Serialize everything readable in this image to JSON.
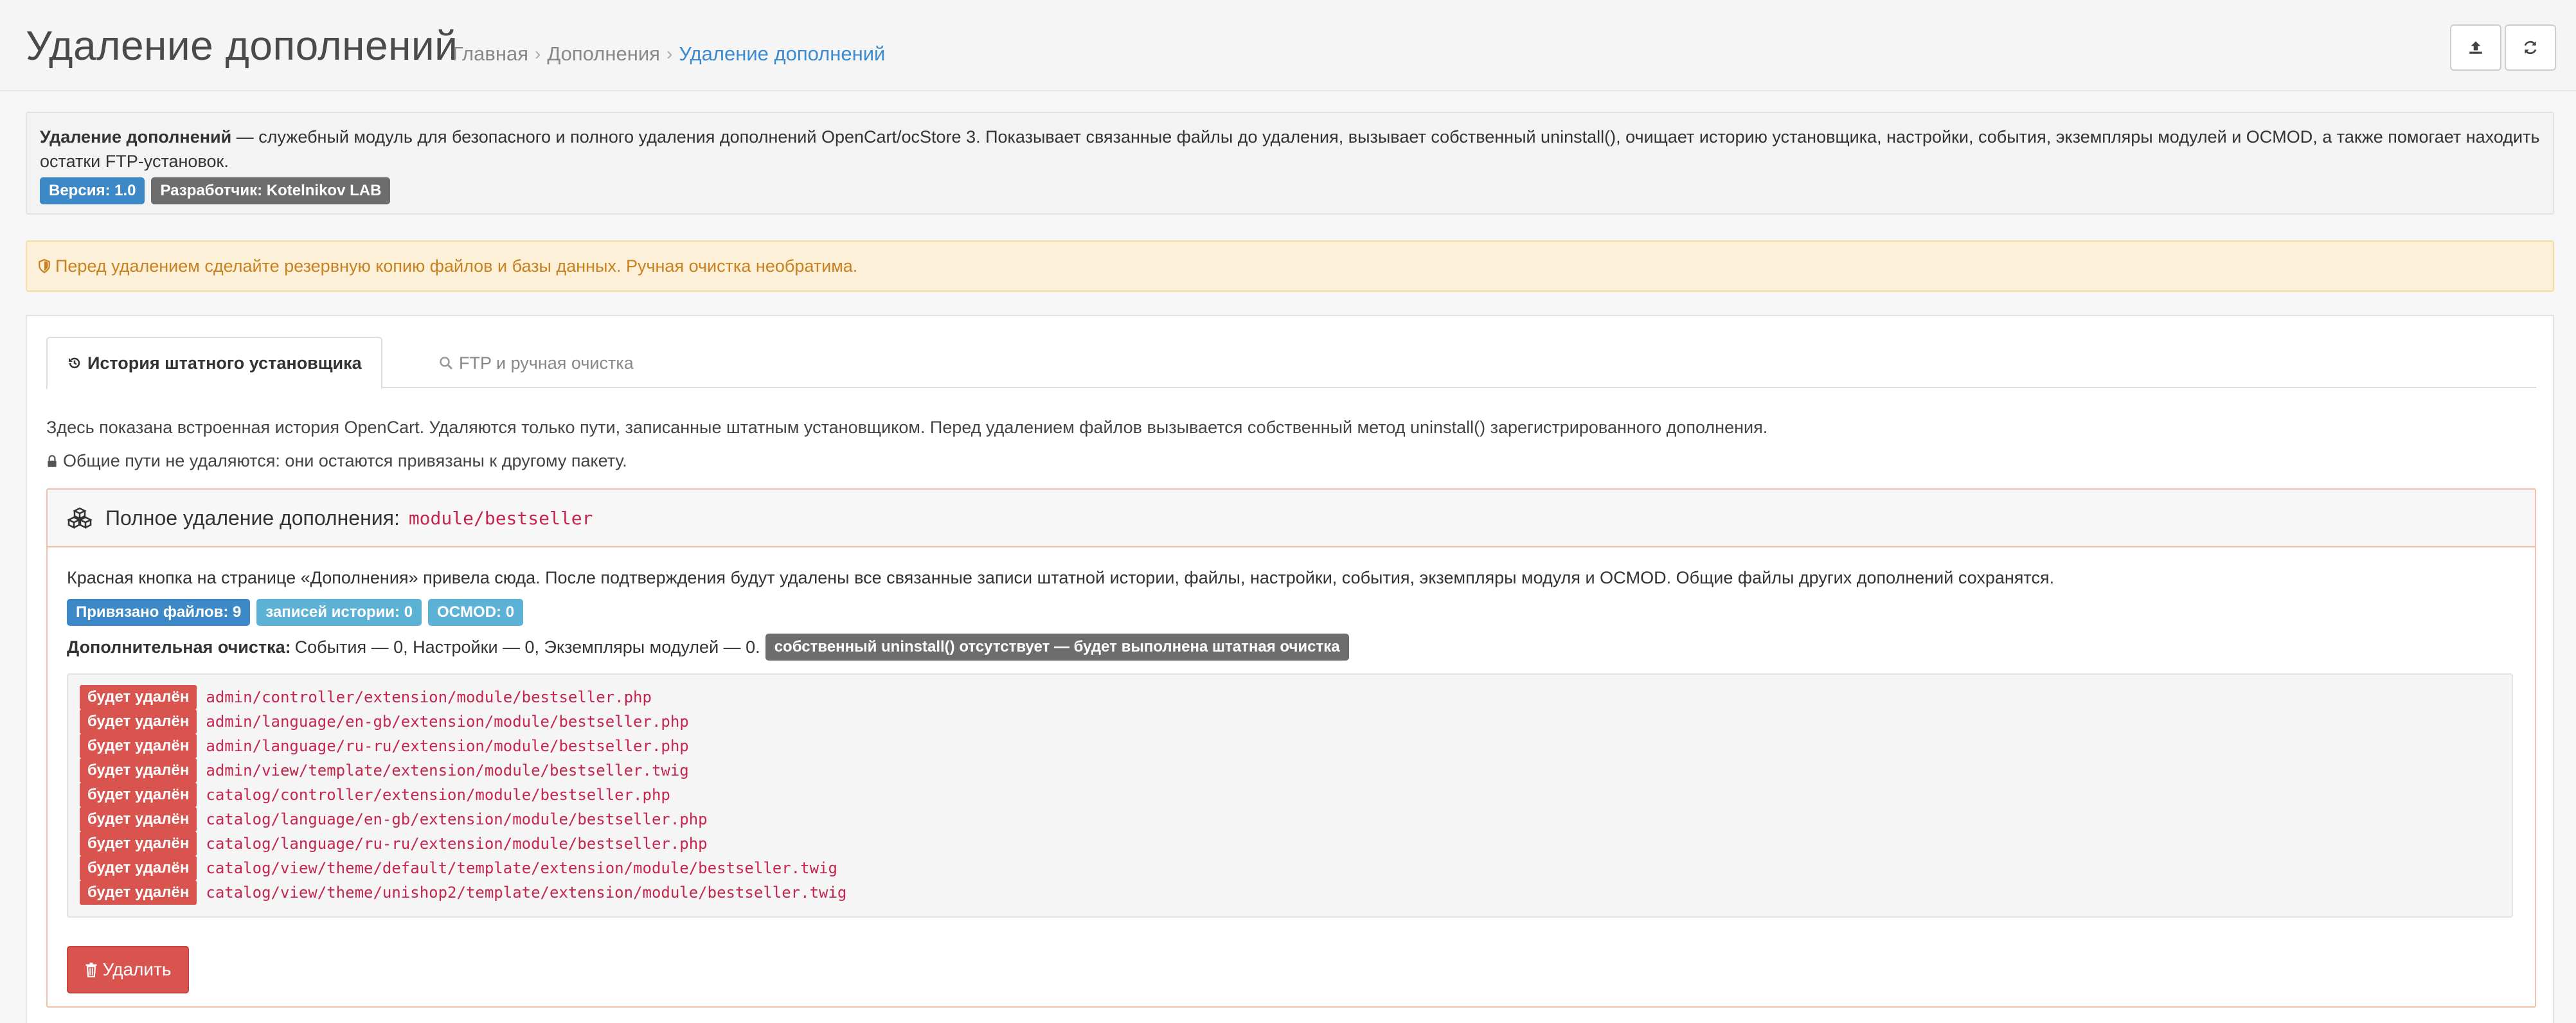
{
  "header": {
    "title": "Удаление дополнений",
    "breadcrumb": [
      "Главная",
      "Дополнения",
      "Удаление дополнений"
    ],
    "buttons": [
      {
        "icon": "upload-icon"
      },
      {
        "icon": "refresh-icon"
      }
    ]
  },
  "info": {
    "module_name": "Удаление дополнений",
    "description": " — служебный модуль для безопасного и полного удаления дополнений OpenCart/ocStore 3. Показывает связанные файлы до удаления, вызывает собственный uninstall(), очищает историю установщика, настройки, события, экземпляры модулей и OCMOD, а также помогает находить остатки FTP-установок.",
    "version_badge": "Версия: 1.0",
    "developer_badge": "Разработчик: Kotelnikov LAB"
  },
  "warning": {
    "text": "Перед удалением сделайте резервную копию файлов и базы данных. Ручная очистка необратима.",
    "icon": "shield-icon"
  },
  "tabs": [
    {
      "label": "История штатного установщика",
      "icon": "history-icon",
      "active": true
    },
    {
      "label": "FTP и ручная очистка",
      "icon": "search-icon",
      "active": false
    }
  ],
  "history_tab": {
    "description": "Здесь показана встроенная история OpenCart. Удаляются только пути, записанные штатным установщиком. Перед удалением файлов вызывается собственный метод uninstall() зарегистрированного дополнения.",
    "note": "Общие пути не удаляются: они остаются привязаны к другому пакету."
  },
  "removal": {
    "title": "Полное удаление дополнения:",
    "code": "module/bestseller",
    "description": "Красная кнопка на странице «Дополнения» привела сюда. После подтверждения будут удалены все связанные записи штатной истории, файлы, настройки, события, экземпляры модуля и OCMOD. Общие файлы других дополнений сохранятся.",
    "badges": {
      "files": "Привязано файлов: 9",
      "history": "записей истории: 0",
      "ocmod": "OCMOD: 0"
    },
    "cleanup_label": "Дополнительная очистка:",
    "cleanup_text": "События — 0, Настройки — 0, Экземпляры модулей — 0.",
    "cleanup_badge": "собственный uninstall() отсутствует — будет выполнена штатная очистка",
    "file_status": "будет удалён",
    "files": [
      "admin/controller/extension/module/bestseller.php",
      "admin/language/en-gb/extension/module/bestseller.php",
      "admin/language/ru-ru/extension/module/bestseller.php",
      "admin/view/template/extension/module/bestseller.twig",
      "catalog/controller/extension/module/bestseller.php",
      "catalog/language/en-gb/extension/module/bestseller.php",
      "catalog/language/ru-ru/extension/module/bestseller.php",
      "catalog/view/theme/default/template/extension/module/bestseller.twig",
      "catalog/view/theme/unishop2/template/extension/module/bestseller.twig"
    ],
    "delete_button": "Удалить"
  },
  "colors": {
    "primary": "#3d89c7",
    "info": "#5bb2d4",
    "danger": "#d9534f",
    "warning_text": "#c9801e",
    "code": "#c7254e"
  }
}
